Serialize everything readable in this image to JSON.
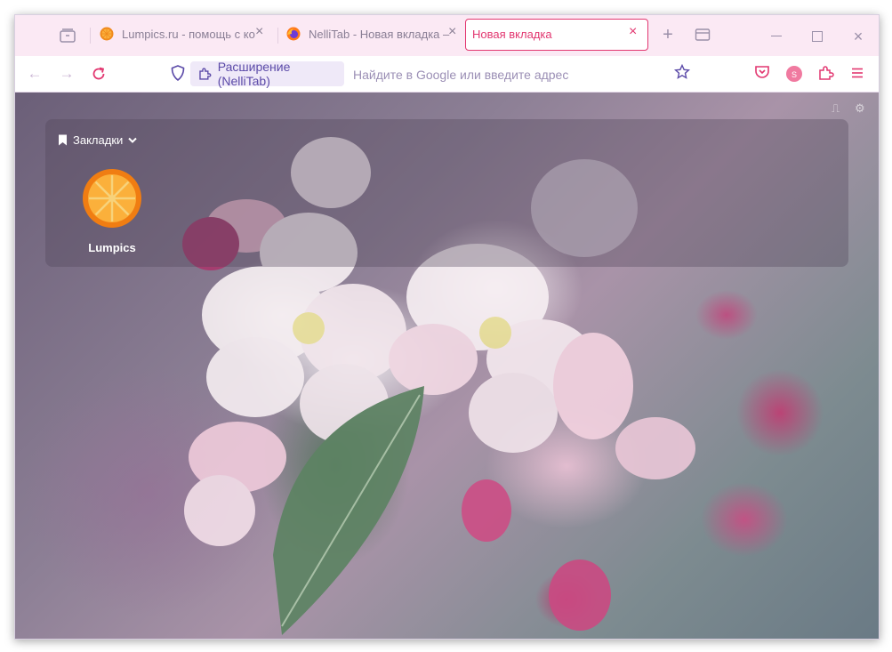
{
  "tabs": [
    {
      "label": "Lumpics.ru - помощь с ком",
      "active": false
    },
    {
      "label": "NelliTab - Новая вкладка – З",
      "active": false
    },
    {
      "label": "Новая вкладка",
      "active": true
    }
  ],
  "address_bar": {
    "extension_chip": "Расширение (NelliTab)",
    "placeholder": "Найдите в Google или введите адрес"
  },
  "account_badge": "S",
  "bookmarks": {
    "header": "Закладки",
    "items": [
      {
        "label": "Lumpics"
      }
    ]
  },
  "colors": {
    "accent": "#e23770",
    "tab_bar_bg": "#fbe9f4",
    "extension_chip_bg": "#efe9f8"
  }
}
